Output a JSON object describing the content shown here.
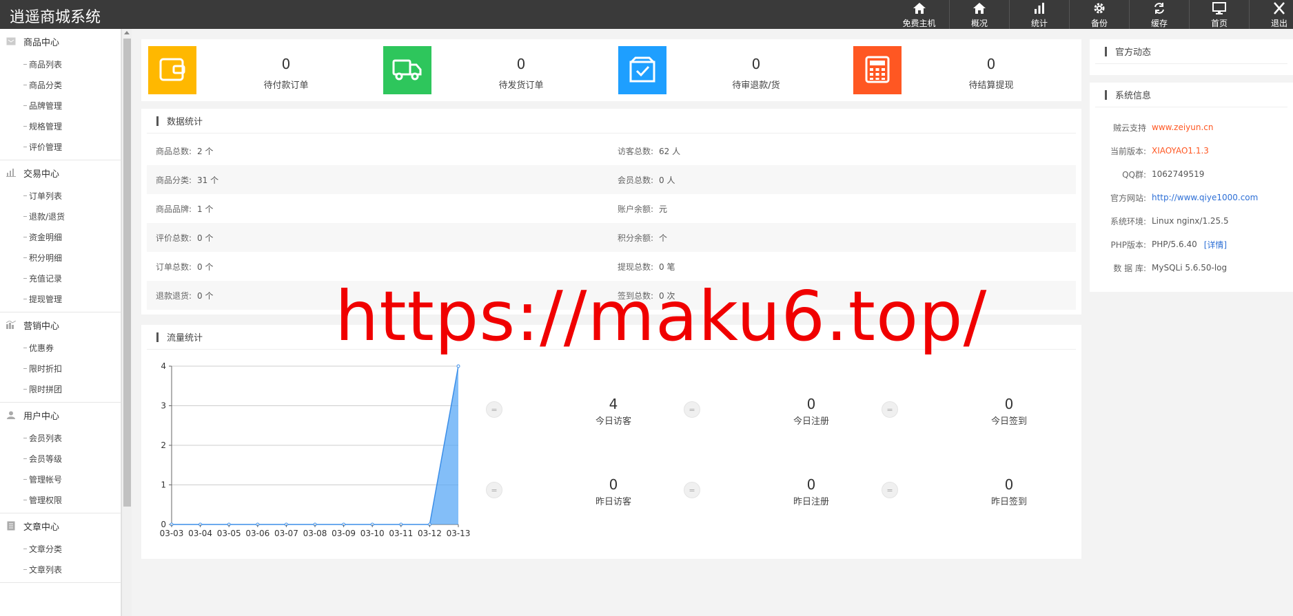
{
  "app": {
    "title": "逍遥商城系统"
  },
  "topnav": [
    {
      "label": "免费主机",
      "icon": "home-icon"
    },
    {
      "label": "概况",
      "icon": "home-icon"
    },
    {
      "label": "统计",
      "icon": "bar-chart-icon"
    },
    {
      "label": "备份",
      "icon": "gear-icon"
    },
    {
      "label": "缓存",
      "icon": "refresh-icon"
    },
    {
      "label": "首页",
      "icon": "monitor-icon"
    },
    {
      "label": "退出",
      "icon": "close-icon"
    }
  ],
  "sidebar": [
    {
      "title": "商品中心",
      "icon": "box-icon",
      "items": [
        "商品列表",
        "商品分类",
        "品牌管理",
        "规格管理",
        "评价管理"
      ]
    },
    {
      "title": "交易中心",
      "icon": "bar-chart-icon",
      "items": [
        "订单列表",
        "退款/退货",
        "资金明细",
        "积分明细",
        "充值记录",
        "提现管理"
      ]
    },
    {
      "title": "营销中心",
      "icon": "chart-icon",
      "items": [
        "优惠券",
        "限时折扣",
        "限时拼团"
      ]
    },
    {
      "title": "用户中心",
      "icon": "user-icon",
      "items": [
        "会员列表",
        "会员等级",
        "管理帐号",
        "管理权限"
      ]
    },
    {
      "title": "文章中心",
      "icon": "document-icon",
      "items": [
        "文章分类",
        "文章列表"
      ]
    }
  ],
  "cards": [
    {
      "value": "0",
      "label": "待付款订单",
      "color": "#ffb800",
      "icon": "wallet-icon"
    },
    {
      "value": "0",
      "label": "待发货订单",
      "color": "#2ec65c",
      "icon": "truck-icon"
    },
    {
      "value": "0",
      "label": "待审退款/货",
      "color": "#1e9fff",
      "icon": "checkbox-icon"
    },
    {
      "value": "0",
      "label": "待结算提现",
      "color": "#ff5722",
      "icon": "calculator-icon"
    }
  ],
  "datastats": {
    "title": "数据统计",
    "rows": [
      {
        "l_label": "商品总数:",
        "l_value": "2 个",
        "r_label": "访客总数:",
        "r_value": "62 人"
      },
      {
        "l_label": "商品分类:",
        "l_value": "31 个",
        "r_label": "会员总数:",
        "r_value": "0 人"
      },
      {
        "l_label": "商品品牌:",
        "l_value": "1 个",
        "r_label": "账户余额:",
        "r_value": "元"
      },
      {
        "l_label": "评价总数:",
        "l_value": "0 个",
        "r_label": "积分余额:",
        "r_value": "个"
      },
      {
        "l_label": "订单总数:",
        "l_value": "0 个",
        "r_label": "提现总数:",
        "r_value": "0 笔"
      },
      {
        "l_label": "退款退货:",
        "l_value": "0 个",
        "r_label": "签到总数:",
        "r_value": "0 次"
      }
    ]
  },
  "traffic": {
    "title": "流量统计",
    "kpis": [
      {
        "value": "4",
        "label": "今日访客"
      },
      {
        "value": "0",
        "label": "今日注册"
      },
      {
        "value": "0",
        "label": "今日签到"
      },
      {
        "value": "0",
        "label": "昨日访客"
      },
      {
        "value": "0",
        "label": "昨日注册"
      },
      {
        "value": "0",
        "label": "昨日签到"
      }
    ],
    "separator_glyph": "="
  },
  "chart_data": {
    "type": "area",
    "categories": [
      "03-03",
      "03-04",
      "03-05",
      "03-06",
      "03-07",
      "03-08",
      "03-09",
      "03-10",
      "03-11",
      "03-12",
      "03-13"
    ],
    "values": [
      0,
      0,
      0,
      0,
      0,
      0,
      0,
      0,
      0,
      0,
      4
    ],
    "ylim": [
      0,
      4
    ],
    "yticks": [
      "0",
      "1",
      "2",
      "3",
      "4"
    ],
    "grid": true,
    "color": "#5aa8f5"
  },
  "news": {
    "title": "官方动态"
  },
  "sysinfo": {
    "title": "系统信息",
    "rows": [
      {
        "label": "贼云支持",
        "value": "www.zeiyun.cn",
        "style": "orange"
      },
      {
        "label": "当前版本:",
        "value": "XIAOYAO1.1.3",
        "style": "orange"
      },
      {
        "label": "QQ群:",
        "value": "1062749519",
        "style": "plain"
      },
      {
        "label": "官方网站:",
        "value": "http://www.qiye1000.com",
        "style": "blue"
      },
      {
        "label": "系统环境:",
        "value": "Linux nginx/1.25.5",
        "style": "plain"
      },
      {
        "label": "PHP版本:",
        "value": "PHP/5.6.40",
        "extra": "[详情]",
        "style": "plain"
      },
      {
        "label": "数 据 库:",
        "value": "MySQLi 5.6.50-log",
        "style": "plain"
      }
    ]
  },
  "watermark": "https://maku6.top/"
}
